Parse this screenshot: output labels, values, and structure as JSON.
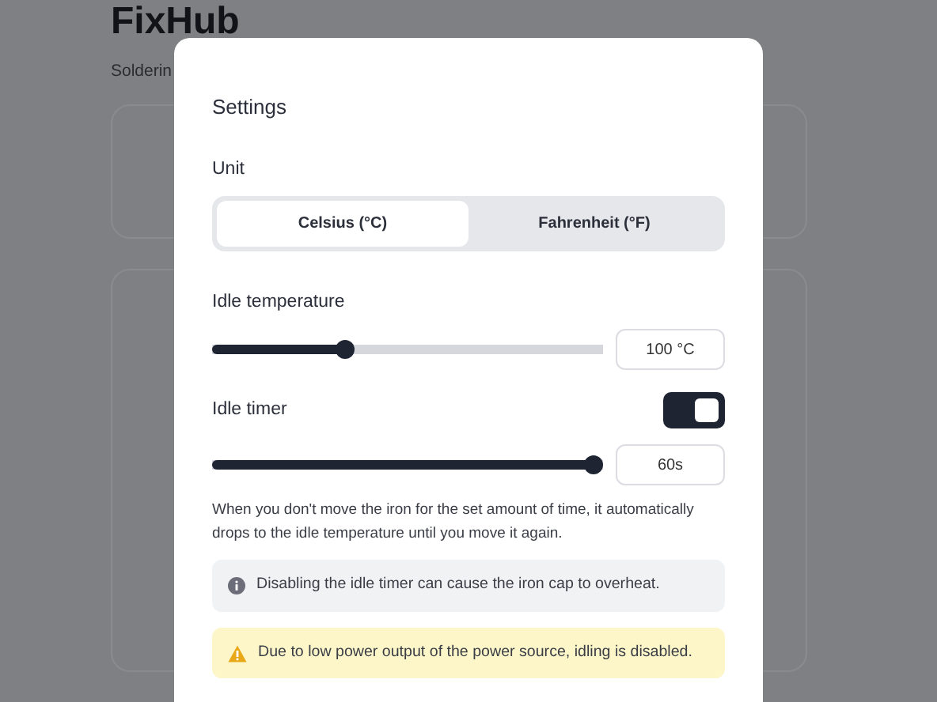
{
  "page": {
    "title": "FixHub",
    "subtitle": "Solderin"
  },
  "dialog": {
    "title": "Settings",
    "unit": {
      "label": "Unit",
      "options": [
        {
          "label": "Celsius (°C)",
          "selected": true
        },
        {
          "label": "Fahrenheit (°F)",
          "selected": false
        }
      ]
    },
    "idle_temperature": {
      "label": "Idle temperature",
      "level": 0.33,
      "value": "100 °C"
    },
    "idle_timer": {
      "label": "Idle timer",
      "on": true,
      "level": 1.0,
      "value": "60s",
      "description": "When you don't move the iron for the set amount of time, it automatically drops to the idle temperature until you move it again."
    },
    "alerts": [
      {
        "kind": "info",
        "text": "Disabling the idle timer can cause the iron cap to overheat."
      },
      {
        "kind": "warning",
        "text": "Due to low power output of the power source, idling is disabled."
      }
    ]
  }
}
